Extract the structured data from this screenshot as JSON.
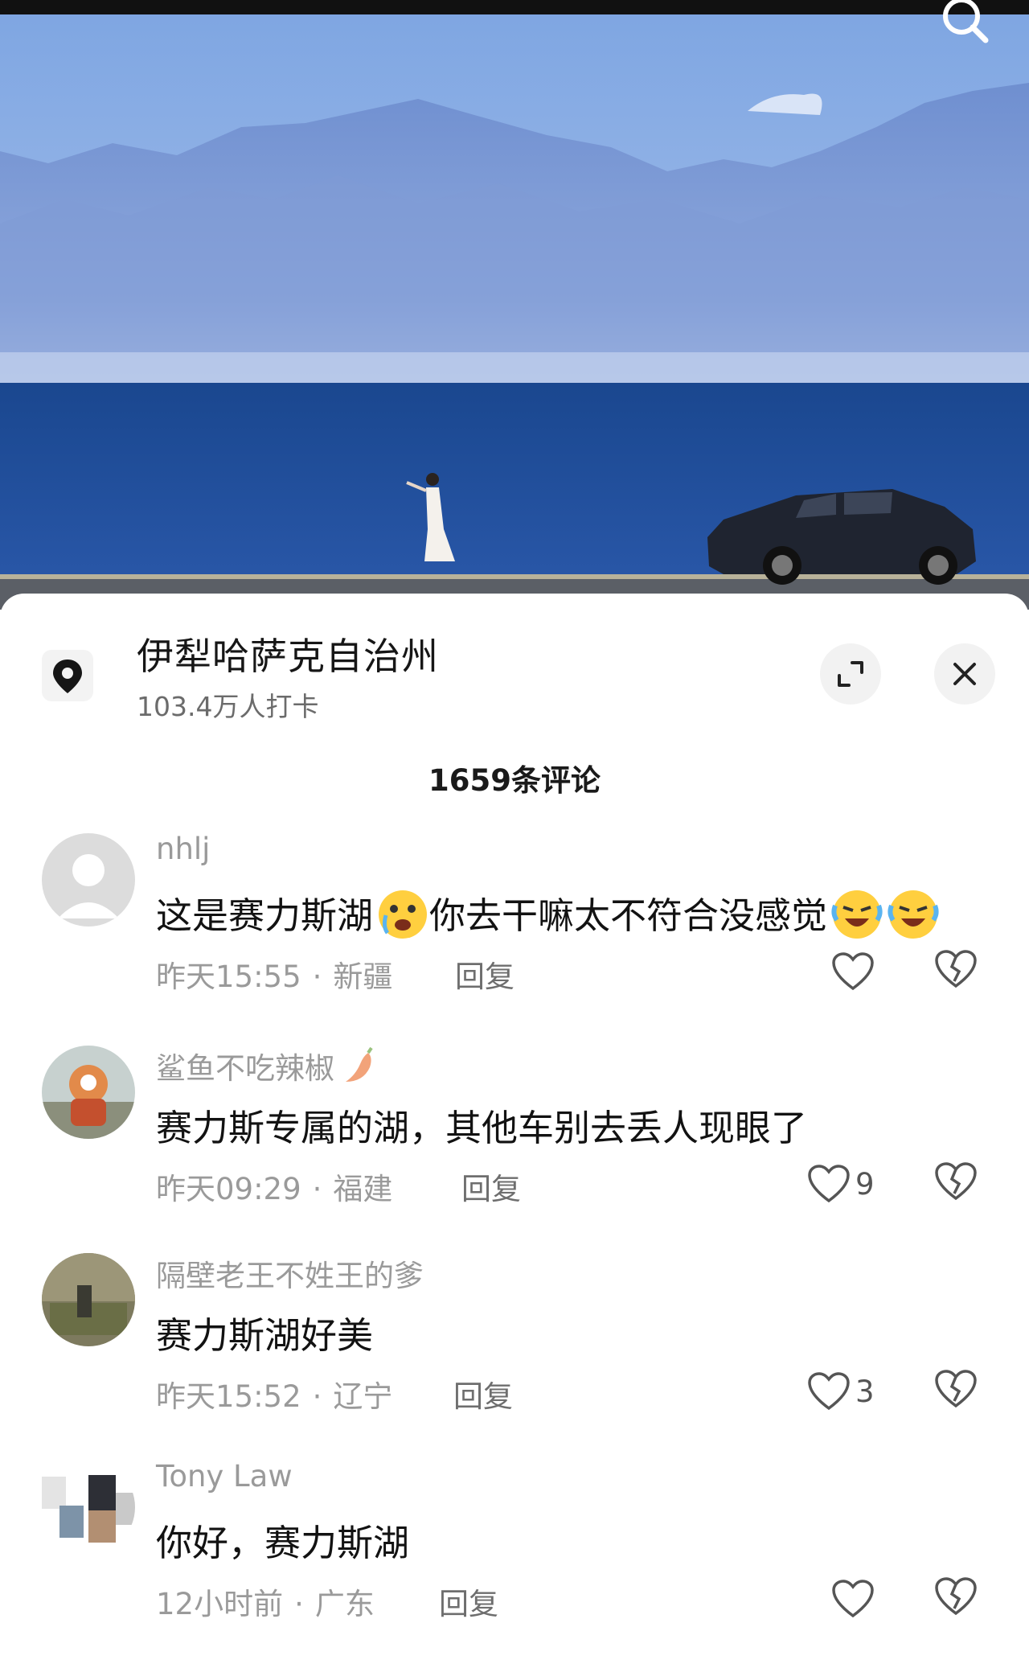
{
  "location": {
    "name": "伊犁哈萨克自治州",
    "checkins": "103.4万人打卡"
  },
  "comments_header": "1659条评论",
  "comments": [
    {
      "username": "nhlj",
      "text": "这是赛力斯湖",
      "text2": "你去干嘛太不符合没感觉",
      "time": "昨天15:55",
      "region": "新疆",
      "reply": "回复",
      "likes": ""
    },
    {
      "username": "鲨鱼不吃辣椒",
      "text": "赛力斯专属的湖，其他车别去丢人现眼了",
      "time": "昨天09:29",
      "region": "福建",
      "reply": "回复",
      "likes": "9"
    },
    {
      "username": "隔壁老王不姓王的爹",
      "text": "赛力斯湖好美",
      "time": "昨天15:52",
      "region": "辽宁",
      "reply": "回复",
      "likes": "3"
    },
    {
      "username": "Tony Law",
      "text": "你好，赛力斯湖",
      "time": "12小时前",
      "region": "广东",
      "reply": "回复",
      "likes": ""
    }
  ],
  "meta_separator": "·",
  "icons": [
    "search-icon",
    "location-pin-icon",
    "expand-icon",
    "close-icon",
    "heart-icon",
    "broken-heart-icon"
  ],
  "colors": {
    "sky": "#8fb3e6",
    "lake": "#1d4a96",
    "text": "#121212",
    "muted": "#9a9a9a"
  }
}
